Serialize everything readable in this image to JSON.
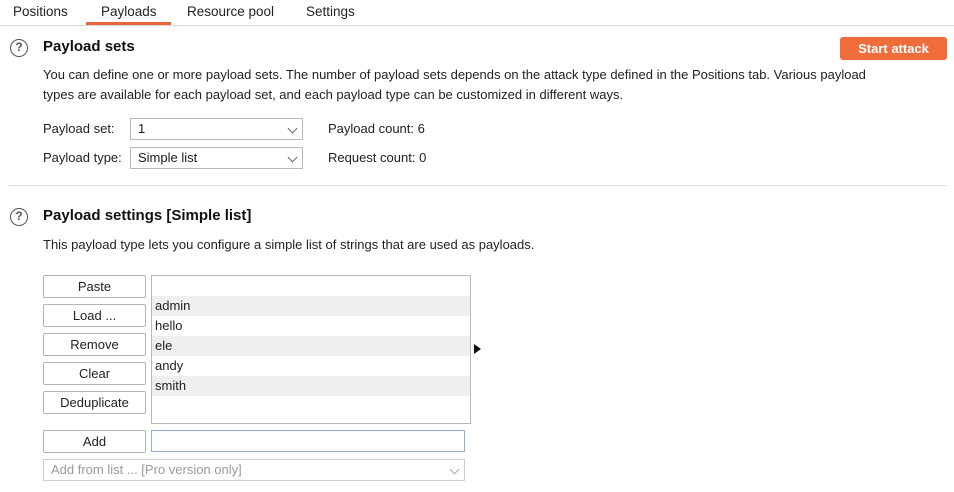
{
  "tabs": [
    {
      "label": "Positions"
    },
    {
      "label": "Payloads"
    },
    {
      "label": "Resource pool"
    },
    {
      "label": "Settings"
    }
  ],
  "active_tab": "Payloads",
  "accent_color": "#f06c3a",
  "payload_sets": {
    "title": "Payload sets",
    "help_icon": "question-circle-icon",
    "description_line1": "You can define one or more payload sets. The number of payload sets depends on the attack type defined in the Positions tab. Various payload",
    "description_line2": "types are available for each payload set, and each payload type can be customized in different ways.",
    "start_attack_label": "Start attack",
    "payload_set_label": "Payload set:",
    "payload_set_value": "1",
    "payload_type_label": "Payload type:",
    "payload_type_value": "Simple list",
    "payload_count_label": "Payload count:",
    "payload_count_value": "6",
    "request_count_label": "Request count:",
    "request_count_value": "0"
  },
  "payload_settings": {
    "title": "Payload settings [Simple list]",
    "help_icon": "question-circle-icon",
    "description": "This payload type lets you configure a simple list of strings that are used as payloads.",
    "buttons": {
      "paste": "Paste",
      "load": "Load ...",
      "remove": "Remove",
      "clear": "Clear",
      "deduplicate": "Deduplicate",
      "add": "Add"
    },
    "list_items": [
      "admin",
      "hello",
      "ele",
      "andy",
      "smith"
    ],
    "add_input_value": "",
    "add_from_list_placeholder": "Add from list ... [Pro version only]"
  }
}
